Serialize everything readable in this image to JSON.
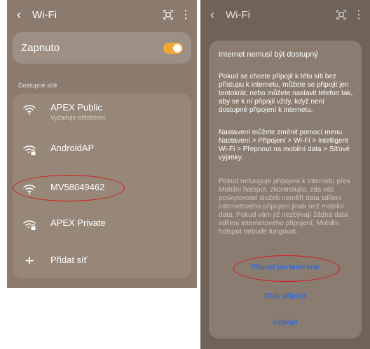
{
  "left": {
    "header": {
      "back_icon": "‹",
      "title": "Wi-Fi",
      "qr_icon": "qr-scan-icon",
      "more_icon": "⋮"
    },
    "toggle": {
      "label": "Zapnuto",
      "on": true
    },
    "section_label": "Dostupné sítě",
    "networks": [
      {
        "name": "APEX Public",
        "sub": "Vyžaduje přihlášení.",
        "icon": "wifi-icon"
      },
      {
        "name": "AndroidAP",
        "sub": "",
        "icon": "wifi-lock-icon"
      },
      {
        "name": "MV58049462",
        "sub": "",
        "icon": "wifi-icon"
      },
      {
        "name": "APEX Private",
        "sub": "",
        "icon": "wifi-lock-icon"
      }
    ],
    "add_network": {
      "label": "Přidat síť",
      "icon": "+"
    }
  },
  "right": {
    "header": {
      "back_icon": "‹",
      "title": "Wi-Fi",
      "qr_icon": "qr-scan-icon",
      "more_icon": "⋮"
    },
    "dialog": {
      "title": "Internet nemusí být dostupný",
      "p1": "Pokud se chcete připojit k této síti bez přístupu k internetu, můžete se připojit jen tentokrát, nebo můžete nastavit telefon tak, aby se k ní připojil vždy, když není dostupné připojení k internetu.",
      "p2": "Nastavení můžete změnit pomocí menu Nastavení > Připojení > Wi-Fi > Intelligent Wi-Fi > Přepnout na mobilní data > Síťové výjimky.",
      "p3": "Pokud nefunguje připojení k internetu přes Mobilní hotspot, zkontrolujte, zda váš poskytovatel služeb neměří data sdílení internetového připojení jinak než mobilní data. Pokud vám již nezbývají žádná data sdílení internetového připojení, Mobilní hotspot nebude fungovat.",
      "btn_once": "Připojit jen tentokrát",
      "btn_always": "Vždy připojit",
      "btn_disconnect": "Odpojit"
    }
  },
  "colors": {
    "accent": "#f2a735",
    "link": "#2f6ad8",
    "highlight": "#e0121b"
  }
}
